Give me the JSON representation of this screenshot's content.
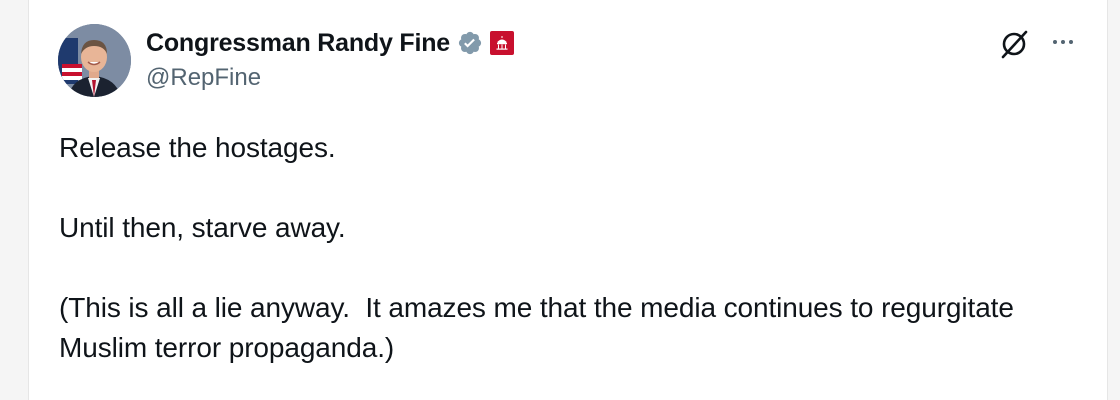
{
  "author": {
    "display_name": "Congressman Randy Fine",
    "handle": "@RepFine",
    "avatar": "avatar-icon",
    "verified_badge": "verified-badge-icon",
    "affiliation_badge": "congress-affiliation-icon"
  },
  "toolbar": {
    "grok_icon": "grok-icon",
    "more_icon": "more-options-icon"
  },
  "tweet": {
    "paragraphs": [
      "Release the hostages.",
      "Until then, starve away.",
      "(This is all a lie anyway.  It amazes me that the media continues to regurgitate Muslim terror propaganda.)"
    ]
  },
  "colors": {
    "text_primary": "#0f1419",
    "text_secondary": "#536471",
    "verified_gray": "#829aab",
    "affiliation_red": "#c8102e"
  }
}
